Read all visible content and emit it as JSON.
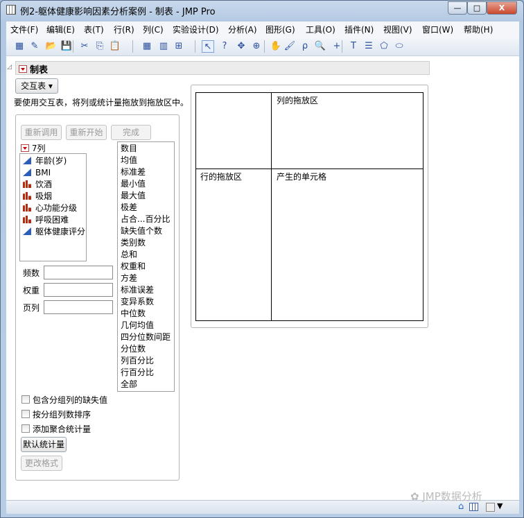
{
  "window": {
    "title": "例2-躯体健康影响因素分析案例 - 制表 - JMP Pro",
    "minimize": "—",
    "maximize": "□",
    "close": "X"
  },
  "menu": [
    "文件(F)",
    "编辑(E)",
    "表(T)",
    "行(R)",
    "列(C)",
    "实验设计(D)",
    "分析(A)",
    "图形(G)",
    "工具(O)",
    "插件(N)",
    "视图(V)",
    "窗口(W)",
    "帮助(H)"
  ],
  "toolbar": {
    "icons": [
      "new-table-icon",
      "new-script-icon",
      "open-icon",
      "save-icon",
      "cut-icon",
      "copy-icon",
      "paste-icon",
      "data-table-icon",
      "columns-icon",
      "add-image-icon",
      "arrow-icon",
      "help-icon",
      "crosshair-icon",
      "target-icon",
      "hand-icon",
      "brush-icon",
      "lasso-icon",
      "magnifier-icon",
      "plus-icon",
      "text-icon",
      "line-icon",
      "polygon-icon",
      "ellipse-icon"
    ]
  },
  "outline": {
    "title": "制表"
  },
  "mode_button": "交互表",
  "instruction": "要使用交互表，将列或统计量拖放到拖放区中。",
  "buttons": {
    "recall": "重新调用",
    "restart": "重新开始",
    "done": "完成",
    "default_stats": "默认统计量",
    "change_format": "更改格式"
  },
  "columns": {
    "header": "7列",
    "items": [
      {
        "name": "年龄(岁)",
        "type": "continuous"
      },
      {
        "name": "BMI",
        "type": "continuous"
      },
      {
        "name": "饮酒",
        "type": "nominal"
      },
      {
        "name": "吸烟",
        "type": "nominal"
      },
      {
        "name": "心功能分级",
        "type": "nominal"
      },
      {
        "name": "呼吸困难",
        "type": "nominal"
      },
      {
        "name": "躯体健康评分",
        "type": "continuous"
      }
    ]
  },
  "stats": [
    "数目",
    "均值",
    "标准差",
    "最小值",
    "最大值",
    "极差",
    "占合...百分比",
    "缺失值个数",
    "类别数",
    "总和",
    "权重和",
    "方差",
    "标准误差",
    "变异系数",
    "中位数",
    "几何均值",
    "四分位数间距",
    "分位数",
    "列百分比",
    "行百分比",
    "全部"
  ],
  "roles": [
    {
      "label": "频数",
      "value": ""
    },
    {
      "label": "权重",
      "value": ""
    },
    {
      "label": "页列",
      "value": ""
    }
  ],
  "checkboxes": [
    {
      "label": "包含分组列的缺失值",
      "checked": false
    },
    {
      "label": "按分组列数排序",
      "checked": false
    },
    {
      "label": "添加聚合统计量",
      "checked": false
    }
  ],
  "drop_zones": {
    "column": "列的拖放区",
    "row": "行的拖放区",
    "cells": "产生的单元格"
  },
  "watermark": "JMP数据分析"
}
